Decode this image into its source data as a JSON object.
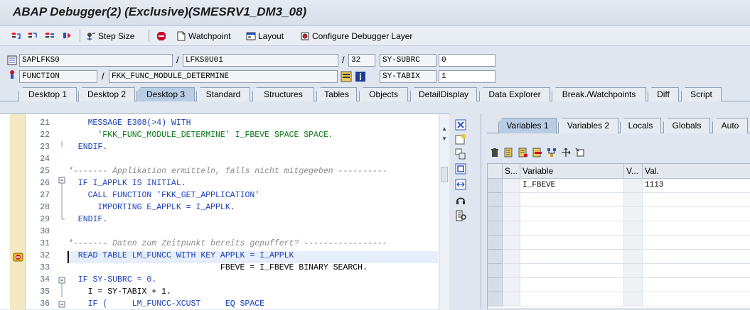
{
  "window": {
    "title": "ABAP Debugger(2)  (Exclusive)(SMESRV1_DM3_08)"
  },
  "toolbar": {
    "step_size": "Step Size",
    "watchpoint": "Watchpoint",
    "layout": "Layout",
    "configure": "Configure Debugger Layer"
  },
  "header": {
    "program": "SAPLFKS0",
    "include": "LFKS0U01",
    "line": "32",
    "subrc_label": "SY-SUBRC",
    "subrc_value": "0",
    "event_type": "FUNCTION",
    "event_name": "FKK_FUNC_MODULE_DETERMINE",
    "tabix_label": "SY-TABIX",
    "tabix_value": "1"
  },
  "tabs": [
    "Desktop 1",
    "Desktop 2",
    "Desktop 3",
    "Standard",
    "Structures",
    "Tables",
    "Objects",
    "DetailDisplay",
    "Data Explorer",
    "Break./Watchpoints",
    "Diff",
    "Script"
  ],
  "active_tab": "Desktop 3",
  "source": {
    "lines": [
      {
        "num": "21",
        "text": "    MESSAGE E308(>4) WITH"
      },
      {
        "num": "22",
        "text": "      'FKK_FUNC_MODULE_DETERMINE' I_FBEVE SPACE SPACE."
      },
      {
        "num": "23",
        "text": "  ENDIF."
      },
      {
        "num": "24",
        "text": ""
      },
      {
        "num": "25",
        "text": "*------- Applikation ermitteln, falls nicht mitgegeben ----------"
      },
      {
        "num": "26",
        "text": "  IF I_APPLK IS INITIAL."
      },
      {
        "num": "27",
        "text": "    CALL FUNCTION 'FKK_GET_APPLICATION'"
      },
      {
        "num": "28",
        "text": "      IMPORTING E_APPLK = I_APPLK."
      },
      {
        "num": "29",
        "text": "  ENDIF."
      },
      {
        "num": "30",
        "text": ""
      },
      {
        "num": "31",
        "text": "*------- Daten zum Zeitpunkt bereits gepuffert? -----------------"
      },
      {
        "num": "32",
        "text": "  READ TABLE LM_FUNCC WITH KEY APPLK = I_APPLK"
      },
      {
        "num": "33",
        "text": "                               FBEVE = I_FBEVE BINARY SEARCH."
      },
      {
        "num": "34",
        "text": "  IF SY-SUBRC = 0."
      },
      {
        "num": "35",
        "text": "    I = SY-TABIX + 1."
      },
      {
        "num": "36",
        "text": "    IF (     LM_FUNCC-XCUST     EQ SPACE"
      }
    ]
  },
  "right": {
    "tabs": [
      "Variables 1",
      "Variables 2",
      "Locals",
      "Globals",
      "Auto"
    ],
    "columns": {
      "s": "S...",
      "variable": "Variable",
      "v": "V...",
      "val": "Val."
    },
    "rows": [
      {
        "variable": "I_FBEVE",
        "val": "1113"
      }
    ]
  }
}
